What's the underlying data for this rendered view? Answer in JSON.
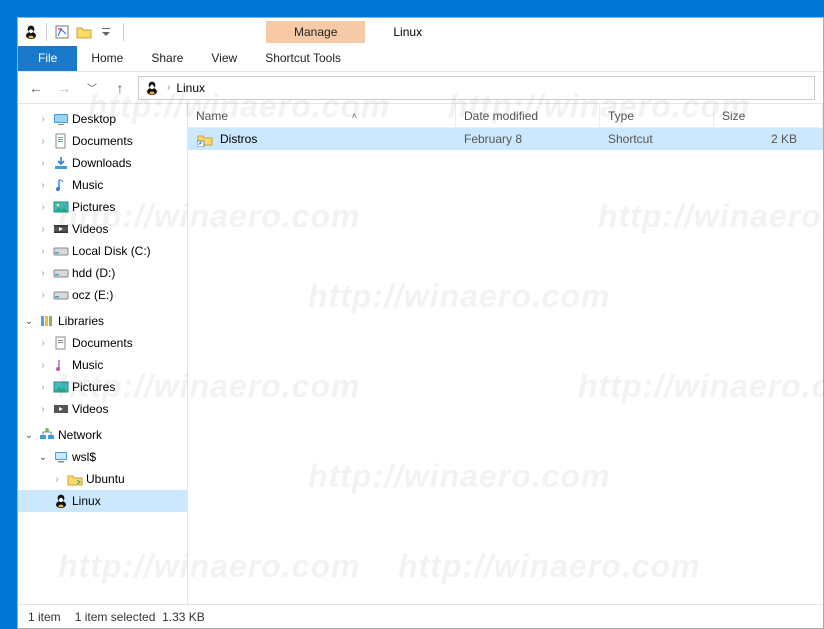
{
  "title": "Linux",
  "context_tab": "Manage",
  "ribbon": {
    "file": "File",
    "tabs": [
      "Home",
      "Share",
      "View"
    ],
    "context_tool": "Shortcut Tools"
  },
  "address": {
    "crumbs": [
      "Linux"
    ]
  },
  "sidebar": {
    "items": [
      {
        "label": "Desktop",
        "icon": "desktop",
        "depth": 1,
        "exp": "closed"
      },
      {
        "label": "Documents",
        "icon": "doc",
        "depth": 1,
        "exp": "closed"
      },
      {
        "label": "Downloads",
        "icon": "download",
        "depth": 1,
        "exp": "closed"
      },
      {
        "label": "Music",
        "icon": "music",
        "depth": 1,
        "exp": "closed"
      },
      {
        "label": "Pictures",
        "icon": "picture",
        "depth": 1,
        "exp": "closed"
      },
      {
        "label": "Videos",
        "icon": "video",
        "depth": 1,
        "exp": "closed"
      },
      {
        "label": "Local Disk (C:)",
        "icon": "disk",
        "depth": 1,
        "exp": "closed"
      },
      {
        "label": "hdd (D:)",
        "icon": "disk",
        "depth": 1,
        "exp": "closed"
      },
      {
        "label": "ocz (E:)",
        "icon": "disk",
        "depth": 1,
        "exp": "closed"
      },
      {
        "label": "Libraries",
        "icon": "libraries",
        "depth": 0,
        "exp": "open"
      },
      {
        "label": "Documents",
        "icon": "doclib",
        "depth": 1,
        "exp": "closed"
      },
      {
        "label": "Music",
        "icon": "musiclib",
        "depth": 1,
        "exp": "closed"
      },
      {
        "label": "Pictures",
        "icon": "piclib",
        "depth": 1,
        "exp": "closed"
      },
      {
        "label": "Videos",
        "icon": "vidlib",
        "depth": 1,
        "exp": "closed"
      },
      {
        "label": "Network",
        "icon": "network",
        "depth": 0,
        "exp": "open"
      },
      {
        "label": "wsl$",
        "icon": "computer",
        "depth": 1,
        "exp": "open"
      },
      {
        "label": "Ubuntu",
        "icon": "share",
        "depth": 2,
        "exp": "closed"
      },
      {
        "label": "Linux",
        "icon": "penguin",
        "depth": 1,
        "exp": "none",
        "selected": true
      }
    ]
  },
  "columns": {
    "name": "Name",
    "date": "Date modified",
    "type": "Type",
    "size": "Size"
  },
  "files": [
    {
      "name": "Distros",
      "date": "February 8",
      "type": "Shortcut",
      "size": "2 KB",
      "selected": true
    }
  ],
  "status": {
    "count": "1 item",
    "selection": "1 item selected",
    "sel_size": "1.33 KB"
  },
  "watermark": "http://winaero.com"
}
